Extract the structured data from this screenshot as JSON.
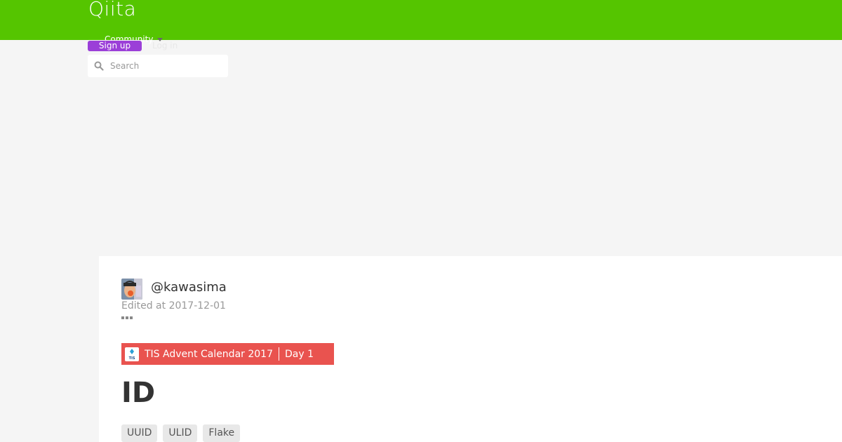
{
  "header": {
    "logo": "Qiita",
    "community": "Community",
    "signup": "Sign up",
    "login": "Log in",
    "search": {
      "placeholder": "Search"
    }
  },
  "article": {
    "username": "@kawasima",
    "edited": "Edited at 2017-12-01",
    "advent": {
      "title": "TIS Advent Calendar 2017",
      "day": "Day 1",
      "logo_text": "TIS"
    },
    "title": "ID",
    "tags": [
      "UUID",
      "ULID",
      "Flake"
    ]
  },
  "colors": {
    "header": "#55c500",
    "signup": "#9b3fd8",
    "advent": "#e9534f"
  }
}
